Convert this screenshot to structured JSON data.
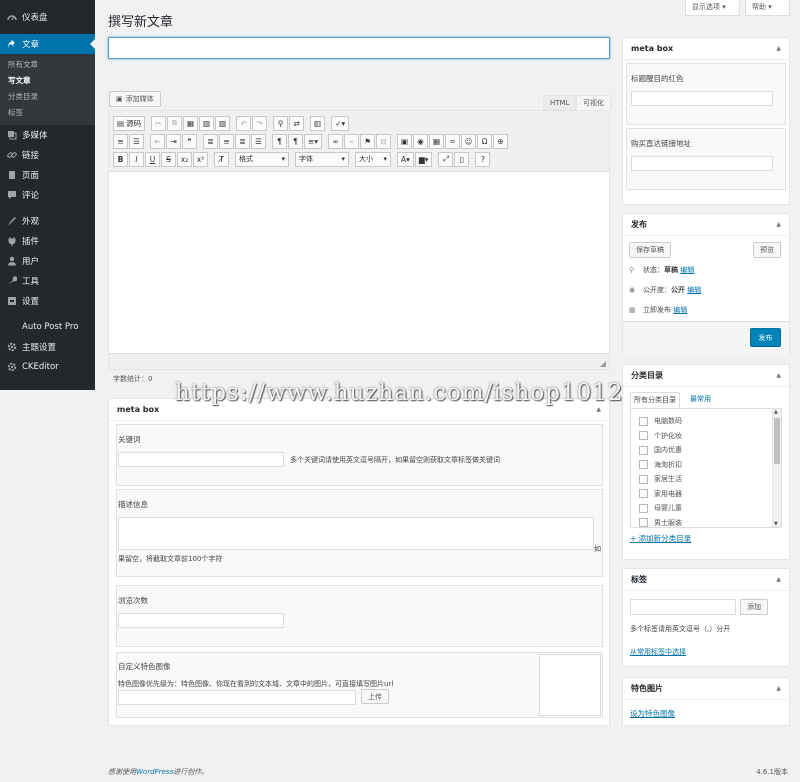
{
  "sidebar": {
    "dashboard": "仪表盘",
    "posts": "文章",
    "sub": [
      "所有文章",
      "写文章",
      "分类目录",
      "标签"
    ],
    "media": "多媒体",
    "links": "链接",
    "pages": "页面",
    "comments": "评论",
    "appearance": "外观",
    "plugins": "插件",
    "users": "用户",
    "tools": "工具",
    "settings": "设置",
    "autopost": "Auto Post Pro",
    "theme": "主题设置",
    "ckeditor": "CKEditor"
  },
  "top": {
    "screen_options": "显示选项 ▾",
    "help": "帮助 ▾"
  },
  "page_title": "撰写新文章",
  "title_input": {
    "value": "",
    "placeholder": ""
  },
  "editor": {
    "add_media": "添加媒体",
    "tab_html": "HTML",
    "tab_visual": "可视化",
    "source": "源码",
    "format": "格式",
    "font": "字体",
    "size": "大小",
    "word_count_label": "字数统计：",
    "word_count": "0"
  },
  "metabox_main": {
    "title": "meta box",
    "keywords_label": "关键词",
    "keywords_hint": "多个关键词请使用英文逗号隔开，如果留空则获取文章标签做关键词",
    "desc_label": "描述信息",
    "desc_hint_end": "如",
    "desc_hint": "果留空，将截取文章前100个字符",
    "views_label": "浏览次数",
    "thumb_label": "自定义特色图像",
    "thumb_hint": "特色图像优先级为：特色图像、你现在看到的文本域、文章中的图片，可直接填写图片url",
    "upload": "上传"
  },
  "metabox_side": {
    "title": "meta box",
    "red_label": "标题醒目的红色",
    "buy_label": "购买直达链接地址"
  },
  "publish": {
    "title": "发布",
    "save_draft": "保存草稿",
    "preview": "预览",
    "status_label": "状态：",
    "status_value": "草稿",
    "edit": "编辑",
    "visibility_label": "公开度：",
    "visibility_value": "公开",
    "schedule_label": "立即发布",
    "publish_btn": "发布"
  },
  "categories": {
    "title": "分类目录",
    "tab_all": "所有分类目录",
    "tab_common": "最常用",
    "items": [
      "电脑数码",
      "个护化妆",
      "国内优惠",
      "海淘折扣",
      "家居生活",
      "家用电器",
      "母婴儿童",
      "男士服装"
    ],
    "add_new": "+ 添加新分类目录"
  },
  "tags": {
    "title": "标签",
    "add": "添加",
    "hint": "多个标签请用英文逗号（,）分开",
    "choose": "从常用标签中选择"
  },
  "featured": {
    "title": "特色图片",
    "set": "设为特色图像"
  },
  "footer": {
    "thanks_pre": "感谢使用",
    "wordpress": "WordPress",
    "thanks_post": "进行创作。",
    "version": "4.6.1版本"
  },
  "watermark": "https://www.huzhan.com/ishop1012",
  "colors": {
    "sidebar": "#23282d",
    "accent": "#0073aa",
    "primary_button": "#0085ba"
  }
}
